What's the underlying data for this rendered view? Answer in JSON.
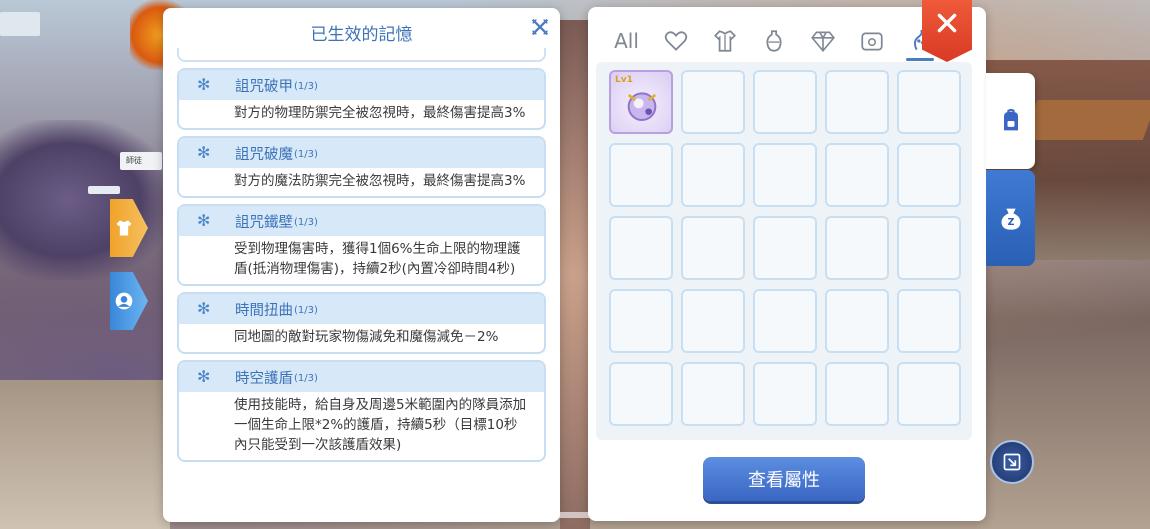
{
  "memory_panel": {
    "title": "已生效的記憶",
    "cards": [
      {
        "name": "詛咒破甲",
        "level": "(1/3)",
        "desc": "對方的物理防禦完全被忽視時，最終傷害提高3%"
      },
      {
        "name": "詛咒破魔",
        "level": "(1/3)",
        "desc": "對方的魔法防禦完全被忽視時，最終傷害提高3%"
      },
      {
        "name": "詛咒鐵壁",
        "level": "(1/3)",
        "desc": "受到物理傷害時，獲得1個6%生命上限的物理護盾(抵消物理傷害)，持續2秒(內置冷卻時間4秒)"
      },
      {
        "name": "時間扭曲",
        "level": "(1/3)",
        "desc": "同地圖的敵對玩家物傷減免和魔傷減免－2%"
      },
      {
        "name": "時空護盾",
        "level": "(1/3)",
        "desc": "使用技能時，給自身及周邊5米範圍內的隊員添加一個生命上限*2%的護盾，持續5秒（目標10秒內只能受到一次該護盾效果)"
      }
    ]
  },
  "inventory_panel": {
    "tabs": [
      {
        "label": "All",
        "icon": "all"
      },
      {
        "label": "",
        "icon": "heart-icon"
      },
      {
        "label": "",
        "icon": "shirt-icon"
      },
      {
        "label": "",
        "icon": "potion-icon"
      },
      {
        "label": "",
        "icon": "diamond-icon"
      },
      {
        "label": "",
        "icon": "card-icon"
      },
      {
        "label": "",
        "icon": "memory-icon"
      }
    ],
    "active_tab": 6,
    "slots": [
      {
        "filled": true,
        "level_tag": "Lv1"
      }
    ],
    "total_slots": 25,
    "view_button": "查看屬性"
  },
  "background": {
    "small_card_text": "師徒"
  },
  "colors": {
    "accent": "#3d74b8",
    "close_red": "#e14a2e",
    "button_blue": "#4a7ad2"
  }
}
